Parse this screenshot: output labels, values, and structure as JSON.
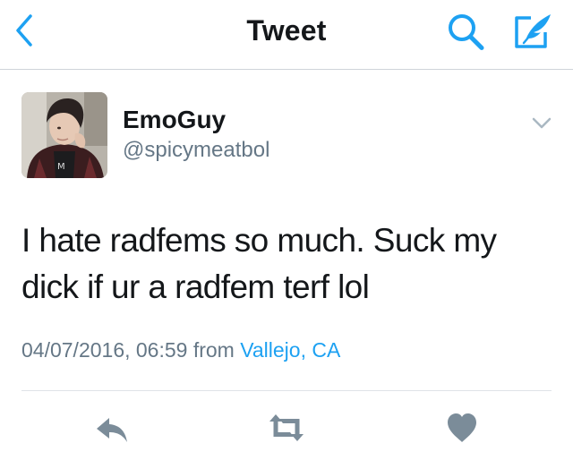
{
  "nav": {
    "title": "Tweet",
    "back_icon": "chevron-left-icon",
    "search_icon": "search-icon",
    "compose_icon": "compose-icon"
  },
  "tweet": {
    "display_name": "EmoGuy",
    "handle": "@spicymeatbol",
    "text": "I hate radfems so much. Suck my dick if ur a radfem terf lol",
    "timestamp": "04/07/2016, 06:59 from",
    "location": "Vallejo, CA"
  },
  "actions": [
    "reply-icon",
    "retweet-icon",
    "like-icon"
  ],
  "colors": {
    "accent": "#1da1f2",
    "text": "#14171a",
    "secondary": "#657786",
    "icon_gray": "#7b8c99"
  }
}
